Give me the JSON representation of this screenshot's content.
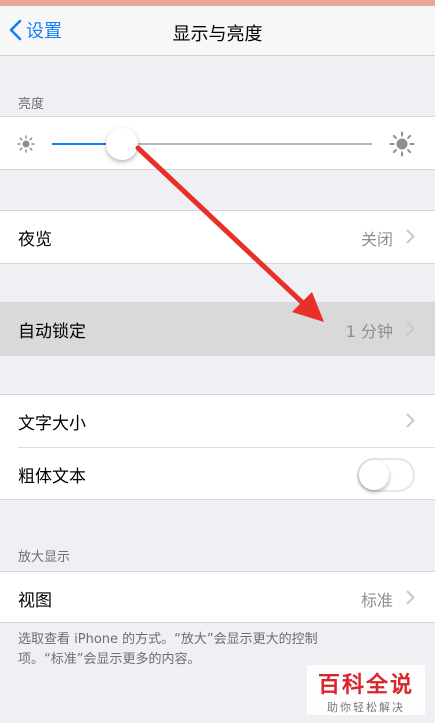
{
  "navbar": {
    "back_label": "设置",
    "title": "显示与亮度"
  },
  "brightness": {
    "header": "亮度",
    "level_percent": 22
  },
  "night_shift": {
    "label": "夜览",
    "value": "关闭"
  },
  "auto_lock": {
    "label": "自动锁定",
    "value": "1 分钟"
  },
  "text": {
    "size_label": "文字大小",
    "bold_label": "粗体文本",
    "bold_on": false
  },
  "zoom": {
    "header": "放大显示",
    "view_label": "视图",
    "view_value": "标准",
    "footnote_line1": "选取查看 iPhone 的方式。“放大”会显示更大的控制",
    "footnote_line2": "项。“标准”会显示更多的内容。"
  },
  "watermark": {
    "main": "百科全说",
    "sub": "助你轻松解决"
  },
  "colors": {
    "accent": "#147efb",
    "annotation_arrow": "#e8302a",
    "highlight_row": "#d9d9d9"
  }
}
